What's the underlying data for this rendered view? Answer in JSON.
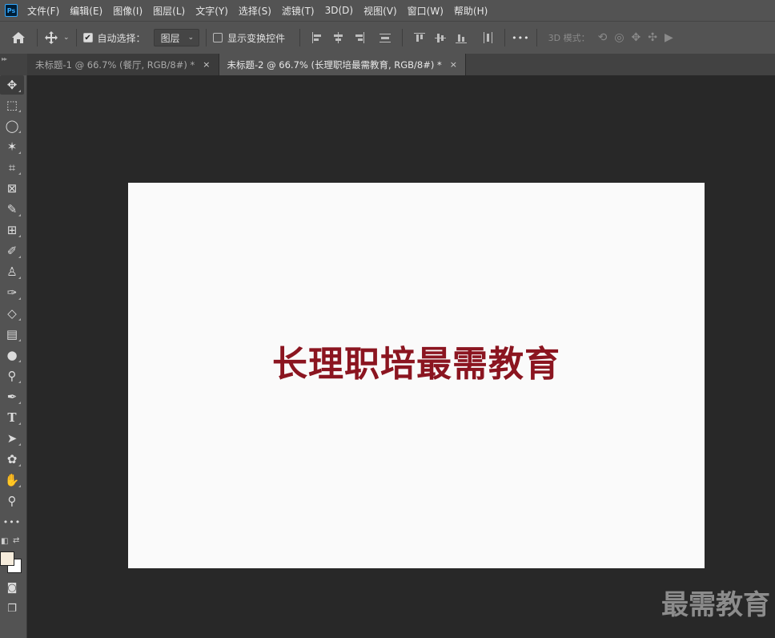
{
  "app": {
    "logo_text": "Ps"
  },
  "menu": [
    "文件(F)",
    "编辑(E)",
    "图像(I)",
    "图层(L)",
    "文字(Y)",
    "选择(S)",
    "滤镜(T)",
    "3D(D)",
    "视图(V)",
    "窗口(W)",
    "帮助(H)"
  ],
  "options": {
    "auto_select_label": "自动选择：",
    "auto_select_checked": true,
    "target_value": "图层",
    "show_transform_label": "显示变换控件",
    "show_transform_checked": false,
    "more": "•••",
    "mode_3d_label": "3D 模式："
  },
  "tabs": [
    {
      "title": "未标题-1 @ 66.7% (餐厅, RGB/8#) *",
      "close": "×",
      "active": false
    },
    {
      "title": "未标题-2 @ 66.7% (长理职培最需教育, RGB/8#) *",
      "close": "×",
      "active": true
    }
  ],
  "tools": [
    {
      "name": "move-tool",
      "icon": "move-icon",
      "glyph": "✥"
    },
    {
      "name": "marquee-tool",
      "icon": "marquee-icon",
      "glyph": "⬚"
    },
    {
      "name": "lasso-tool",
      "icon": "lasso-icon",
      "glyph": "◯"
    },
    {
      "name": "magic-wand-tool",
      "icon": "magic-wand-icon",
      "glyph": "✶"
    },
    {
      "name": "crop-tool",
      "icon": "crop-icon",
      "glyph": "⌗"
    },
    {
      "name": "frame-tool",
      "icon": "frame-icon",
      "glyph": "⊠"
    },
    {
      "name": "eyedropper-tool",
      "icon": "eyedropper-icon",
      "glyph": "✎"
    },
    {
      "name": "healing-tool",
      "icon": "healing-icon",
      "glyph": "⊞"
    },
    {
      "name": "brush-tool",
      "icon": "brush-icon",
      "glyph": "✐"
    },
    {
      "name": "stamp-tool",
      "icon": "stamp-icon",
      "glyph": "♙"
    },
    {
      "name": "history-brush-tool",
      "icon": "history-brush-icon",
      "glyph": "✑"
    },
    {
      "name": "eraser-tool",
      "icon": "eraser-icon",
      "glyph": "◇"
    },
    {
      "name": "gradient-tool",
      "icon": "gradient-icon",
      "glyph": "▤"
    },
    {
      "name": "blur-tool",
      "icon": "blur-icon",
      "glyph": "●"
    },
    {
      "name": "dodge-tool",
      "icon": "dodge-icon",
      "glyph": "⚲"
    },
    {
      "name": "pen-tool",
      "icon": "pen-icon",
      "glyph": "✒"
    },
    {
      "name": "type-tool",
      "icon": "type-icon",
      "glyph": "T"
    },
    {
      "name": "path-select-tool",
      "icon": "path-select-icon",
      "glyph": "➤"
    },
    {
      "name": "shape-tool",
      "icon": "shape-icon",
      "glyph": "✿"
    },
    {
      "name": "hand-tool",
      "icon": "hand-icon",
      "glyph": "✋"
    },
    {
      "name": "zoom-tool",
      "icon": "zoom-icon",
      "glyph": "⚲"
    },
    {
      "name": "more-tools",
      "icon": "more-icon",
      "glyph": "•••"
    }
  ],
  "colors": {
    "foreground": "#f6ecdc",
    "background": "#ffffff",
    "text": "#8b1520"
  },
  "document": {
    "text": "长理职培最需教育"
  },
  "watermark": "最需教育"
}
